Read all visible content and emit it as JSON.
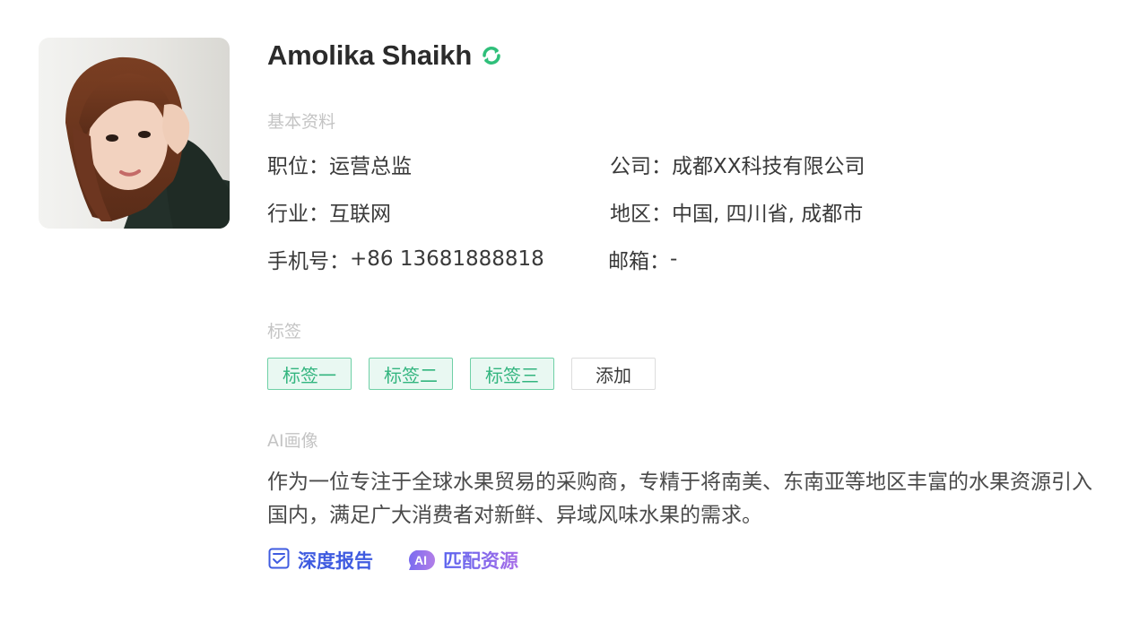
{
  "profile": {
    "name": "Amolika Shaikh",
    "verified_icon": "refresh-verified-icon",
    "accent_color": "#2fbf7a"
  },
  "basic": {
    "title": "基本资料",
    "position_label": "职位：",
    "position_value": "运营总监",
    "company_label": "公司：",
    "company_value": "成都XX科技有限公司",
    "industry_label": "行业：",
    "industry_value": "互联网",
    "region_label": "地区：",
    "region_value": "中国, 四川省, 成都市",
    "phone_label": "手机号：",
    "phone_value": "+86 13681888818",
    "email_label": "邮箱：",
    "email_value": "-"
  },
  "tags": {
    "title": "标签",
    "items": [
      "标签一",
      "标签二",
      "标签三"
    ],
    "add_label": "添加",
    "tag_color": "#33b57f"
  },
  "ai_portrait": {
    "title": "AI画像",
    "description": "作为一位专注于全球水果贸易的采购商，专精于将南美、东南亚等地区丰富的水果资源引入国内，满足广大消费者对新鲜、异域风味水果的需求。"
  },
  "actions": {
    "report_label": "深度报告",
    "report_icon": "report-icon",
    "match_badge": "AI",
    "match_label": "匹配资源",
    "match_icon": "ai-badge-icon",
    "report_color": "#3f5be0"
  }
}
